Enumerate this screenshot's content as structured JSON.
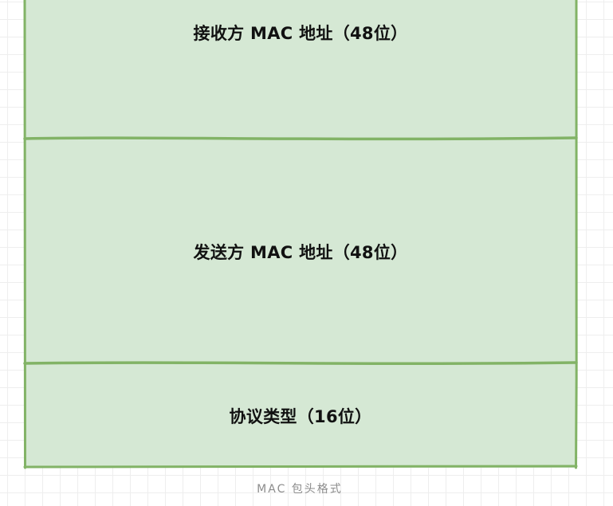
{
  "colors": {
    "fill": "#d5e8d4",
    "stroke": "#82b366",
    "label": "#111111",
    "caption": "#8c8c8c",
    "grid": "#eeeeee"
  },
  "diagram": {
    "rows": [
      {
        "label": "接收方 MAC 地址（48位）"
      },
      {
        "label": "发送方 MAC 地址（48位）"
      },
      {
        "label": "协议类型（16位）"
      }
    ]
  },
  "caption": "MAC 包头格式"
}
